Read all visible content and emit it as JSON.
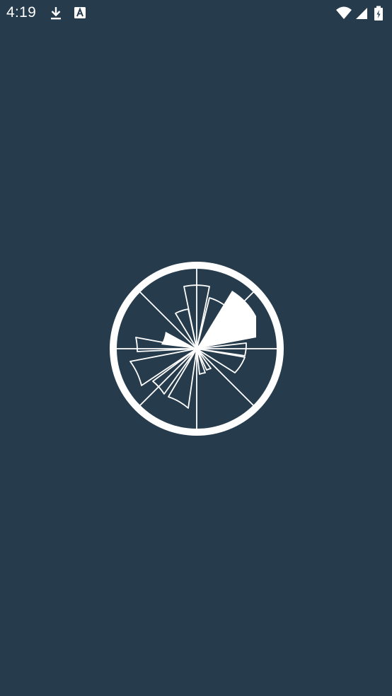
{
  "status_bar": {
    "time": "4:19",
    "left_icons": [
      "download-icon",
      "text-a-icon"
    ],
    "right_icons": [
      "wifi-icon",
      "cell-signal-icon",
      "battery-charging-icon"
    ]
  },
  "splash": {
    "logo": "wind-rose-logo-icon"
  },
  "colors": {
    "background": "#263b4c",
    "foreground": "#ffffff"
  }
}
